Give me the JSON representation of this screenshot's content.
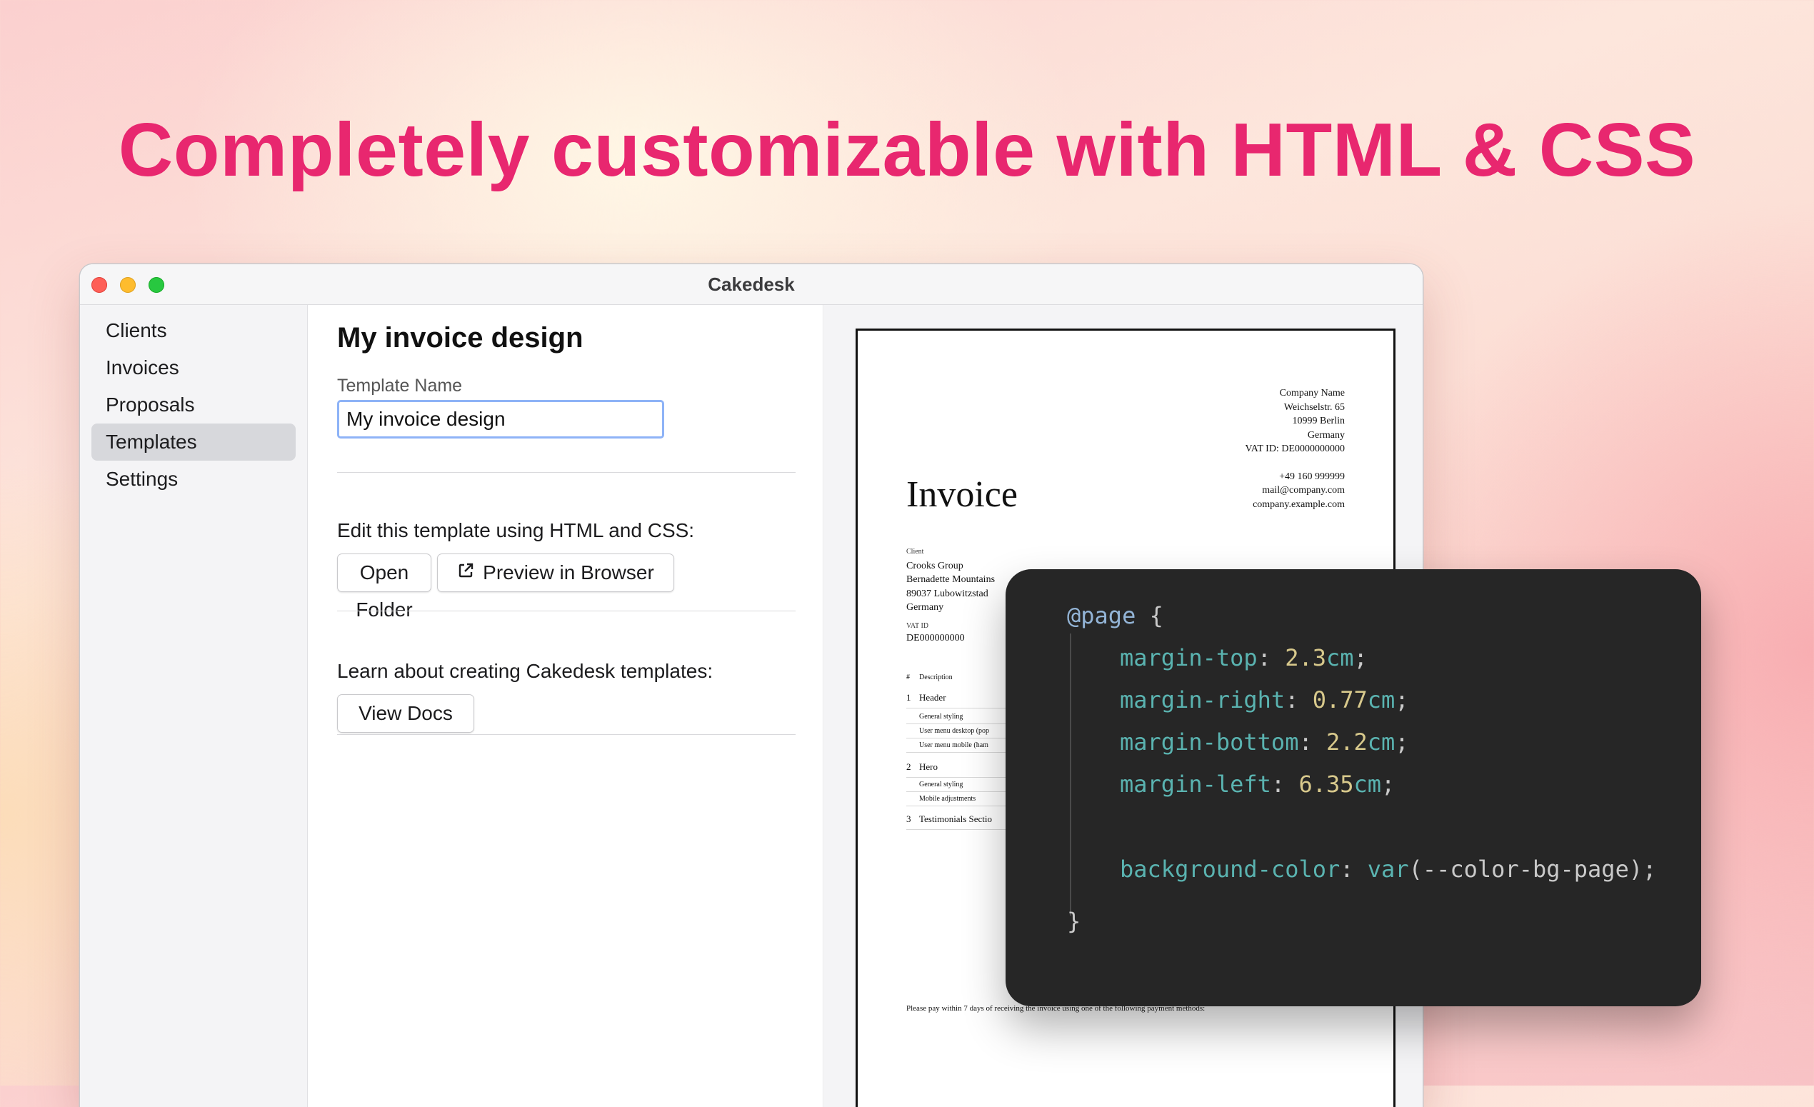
{
  "headline": "Completely customizable with HTML & CSS",
  "window": {
    "title": "Cakedesk"
  },
  "sidebar": {
    "items": [
      {
        "label": "Clients"
      },
      {
        "label": "Invoices"
      },
      {
        "label": "Proposals"
      },
      {
        "label": "Templates",
        "active": true
      },
      {
        "label": "Settings"
      }
    ]
  },
  "content": {
    "title": "My invoice design",
    "template_name_label": "Template Name",
    "template_name_value": "My invoice design",
    "edit_text": "Edit this template using HTML and CSS:",
    "open_folder_label": "Open Folder",
    "preview_browser_label": "Preview in Browser",
    "preview_browser_icon": "external-link-icon",
    "learn_text": "Learn about creating Cakedesk templates:",
    "view_docs_label": "View Docs"
  },
  "invoice_preview": {
    "sender": {
      "company": "Company Name",
      "street": "Weichselstr. 65",
      "city": "10999 Berlin",
      "country": "Germany",
      "vat": "VAT ID: DE0000000000",
      "phone": "+49 160 999999",
      "email": "mail@company.com",
      "website": "company.example.com"
    },
    "title": "Invoice",
    "client": {
      "label": "Client",
      "name": "Crooks Group",
      "contact": "Bernadette Mountains",
      "city": "89037 Lubowitzstad",
      "country": "Germany"
    },
    "vat_label": "VAT ID",
    "vat_value": "DE000000000",
    "items_header_num": "#",
    "items_header_desc": "Description",
    "items": [
      {
        "num": "1",
        "label": "Header",
        "level": 0
      },
      {
        "num": "",
        "label": "General styling",
        "level": 1
      },
      {
        "num": "",
        "label": "User menu desktop (pop",
        "level": 1
      },
      {
        "num": "",
        "label": "User menu mobile (ham",
        "level": 1
      },
      {
        "num": "2",
        "label": "Hero",
        "level": 0
      },
      {
        "num": "",
        "label": "General styling",
        "level": 1
      },
      {
        "num": "",
        "label": "Mobile adjustments",
        "level": 1
      },
      {
        "num": "3",
        "label": "Testimonials Sectio",
        "level": 0
      }
    ],
    "footer_note": "Please pay within 7 days of receiving the invoice using one of the following payment methods:"
  },
  "code": {
    "at_rule": "@page",
    "open_brace": "{",
    "close_brace": "}",
    "declarations": [
      {
        "prop": "margin-top",
        "num": "2.3",
        "unit": "cm"
      },
      {
        "prop": "margin-right",
        "num": "0.77",
        "unit": "cm"
      },
      {
        "prop": "margin-bottom",
        "num": "2.2",
        "unit": "cm"
      },
      {
        "prop": "margin-left",
        "num": "6.35",
        "unit": "cm"
      }
    ],
    "bg_prop": "background-color",
    "bg_fn": "var",
    "bg_arg": "--color-bg-page"
  },
  "colors": {
    "headline": "#e8276f",
    "code_bg": "#262626",
    "input_focus": "#8eb3f7"
  }
}
